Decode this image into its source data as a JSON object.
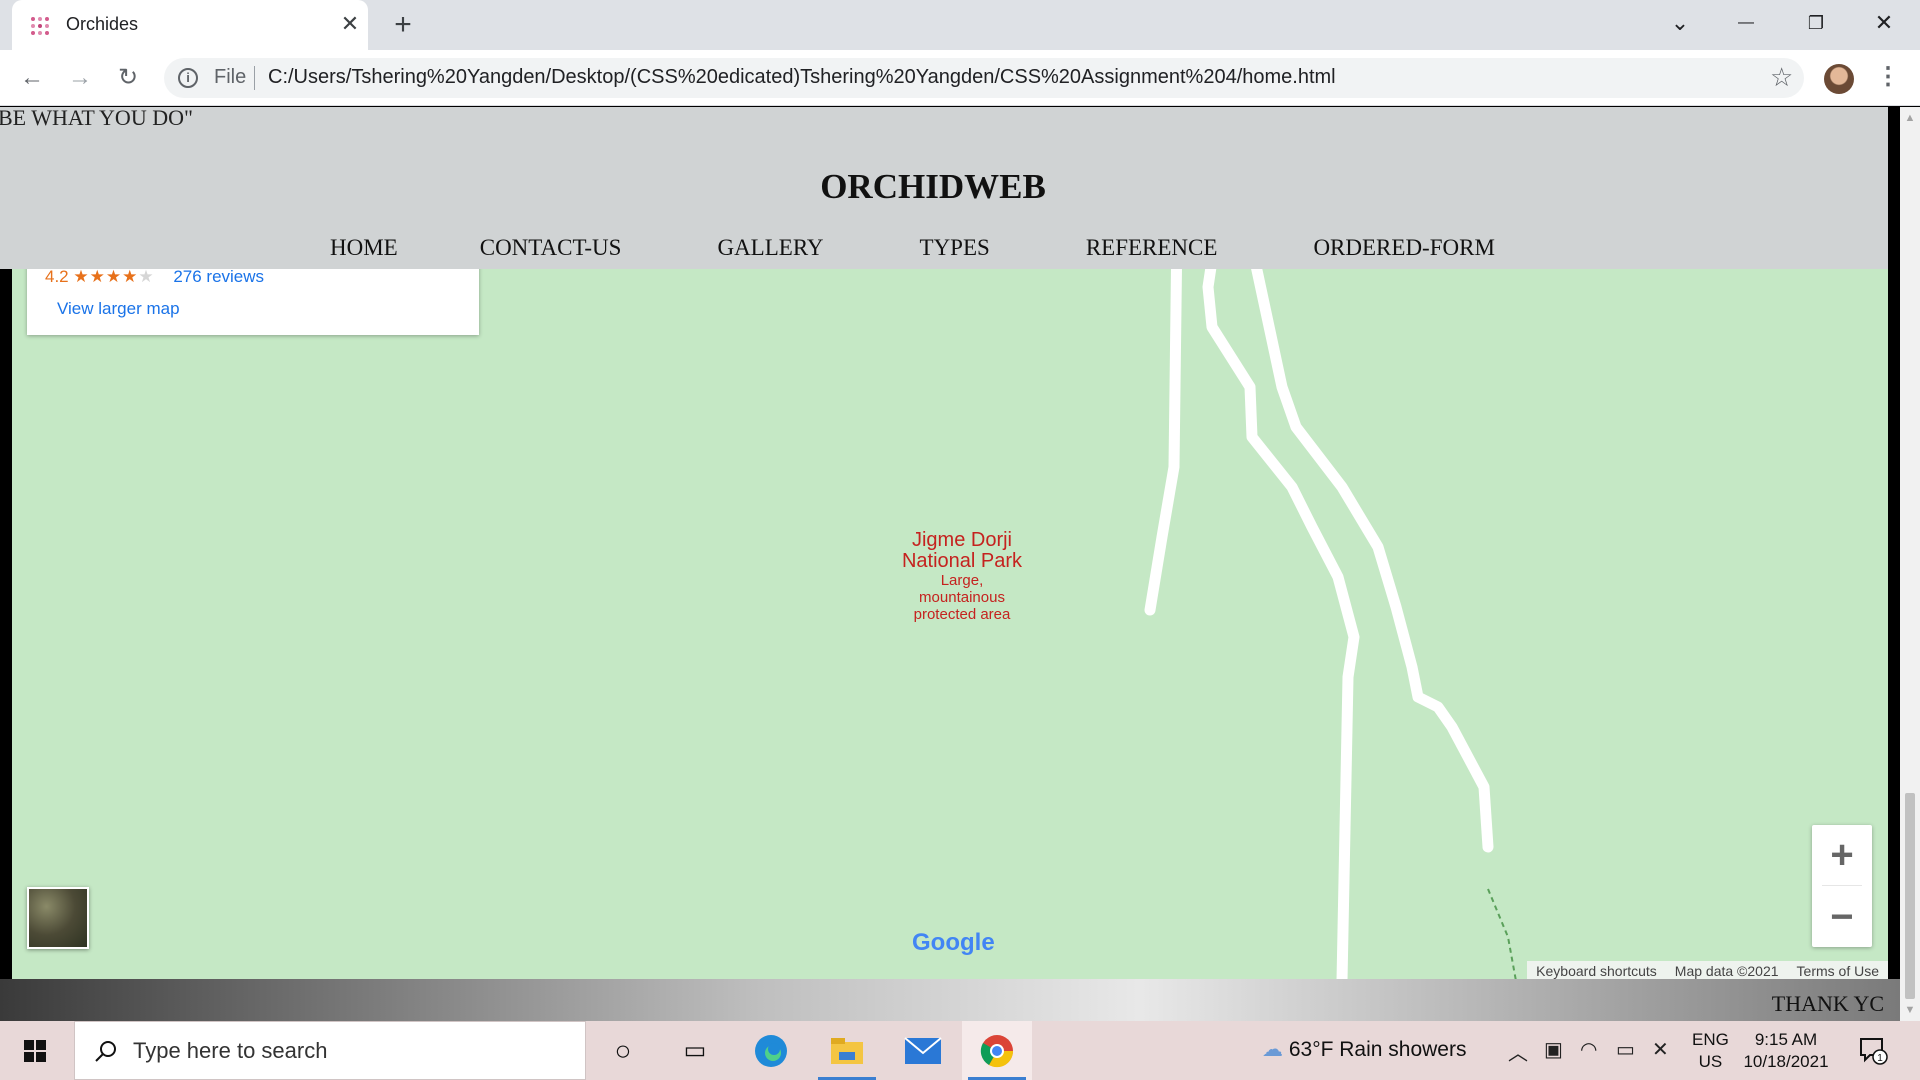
{
  "browser": {
    "tab_title": "Orchides",
    "tab_close": "✕",
    "new_tab": "+",
    "file_label": "File",
    "url": "C:/Users/Tshering%20Yangden/Desktop/(CSS%20edicated)Tshering%20Yangden/CSS%20Assignment%204/home.html",
    "window_controls": {
      "dropdown": "⌄",
      "minimize": "—",
      "restore": "❐",
      "close": "✕"
    }
  },
  "site": {
    "quote": "BE WHAT YOU DO\"",
    "title": "ORCHIDWEB",
    "nav": [
      "HOME",
      "CONTACT-US",
      "GALLERY",
      "TYPES",
      "REFERENCE",
      "ORDERED-FORM"
    ],
    "footer_text": "THANK YC"
  },
  "map": {
    "rating_value": "4.2",
    "rating_stars": 4.2,
    "reviews": "276 reviews",
    "view_larger": "View larger map",
    "place_name_line1": "Jigme Dorji",
    "place_name_line2": "National Park",
    "place_desc_line1": "Large,",
    "place_desc_line2": "mountainous",
    "place_desc_line3": "protected area",
    "google_logo": "Google",
    "attribution": [
      "Keyboard shortcuts",
      "Map data ©2021",
      "Terms of Use"
    ],
    "zoom_in": "+",
    "zoom_out": "−",
    "colors": {
      "land": "#c5e8c5",
      "road": "#ffffff",
      "label": "#c5221f",
      "link": "#1a73e8"
    }
  },
  "taskbar": {
    "search_placeholder": "Type here to search",
    "weather": "63°F  Rain showers",
    "lang_line1": "ENG",
    "lang_line2": "US",
    "time": "9:15 AM",
    "date": "10/18/2021",
    "notification_count": "1",
    "icons": [
      "cortana-icon",
      "task-view-icon",
      "edge-icon",
      "file-explorer-icon",
      "mail-icon",
      "chrome-icon"
    ]
  }
}
